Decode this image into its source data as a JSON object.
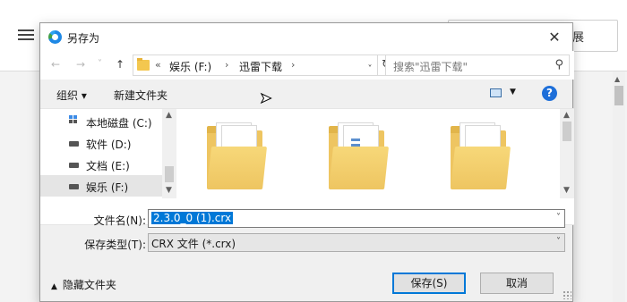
{
  "background": {
    "menu_icon": "hamburger-icon",
    "box_text": "展"
  },
  "dialog": {
    "title": "另存为",
    "close": "✕",
    "nav": {
      "back": "←",
      "forward": "→",
      "recent": "˅",
      "up": "↑",
      "breadcrumb": [
        "«",
        "娱乐 (F:)",
        "›",
        "迅雷下载",
        "›"
      ],
      "dropdown": "˅",
      "refresh": "↻",
      "search_placeholder": "搜索\"迅雷下载\"",
      "search_icon": "⚲"
    },
    "toolbar": {
      "organize": "组织 ▾",
      "new_folder": "新建文件夹",
      "view_dropdown": "▼",
      "help": "?"
    },
    "tree": [
      {
        "label": "本地磁盘 (C:)",
        "icon": "local-disk-icon"
      },
      {
        "label": "软件 (D:)",
        "icon": "drive-icon"
      },
      {
        "label": "文档 (E:)",
        "icon": "drive-icon"
      },
      {
        "label": "娱乐 (F:)",
        "icon": "drive-icon",
        "selected": true
      }
    ],
    "scroll": {
      "up": "▲",
      "down": "▼"
    },
    "form": {
      "filename_label": "文件名(N):",
      "filename_value": "2.3.0_0 (1).crx",
      "filetype_label": "保存类型(T):",
      "filetype_value": "CRX 文件 (*.crx)",
      "dropdown": "˅"
    },
    "bottom": {
      "hide_folders": "隐藏文件夹",
      "hide_chev": "▲",
      "save": "保存(S)",
      "cancel": "取消"
    }
  }
}
